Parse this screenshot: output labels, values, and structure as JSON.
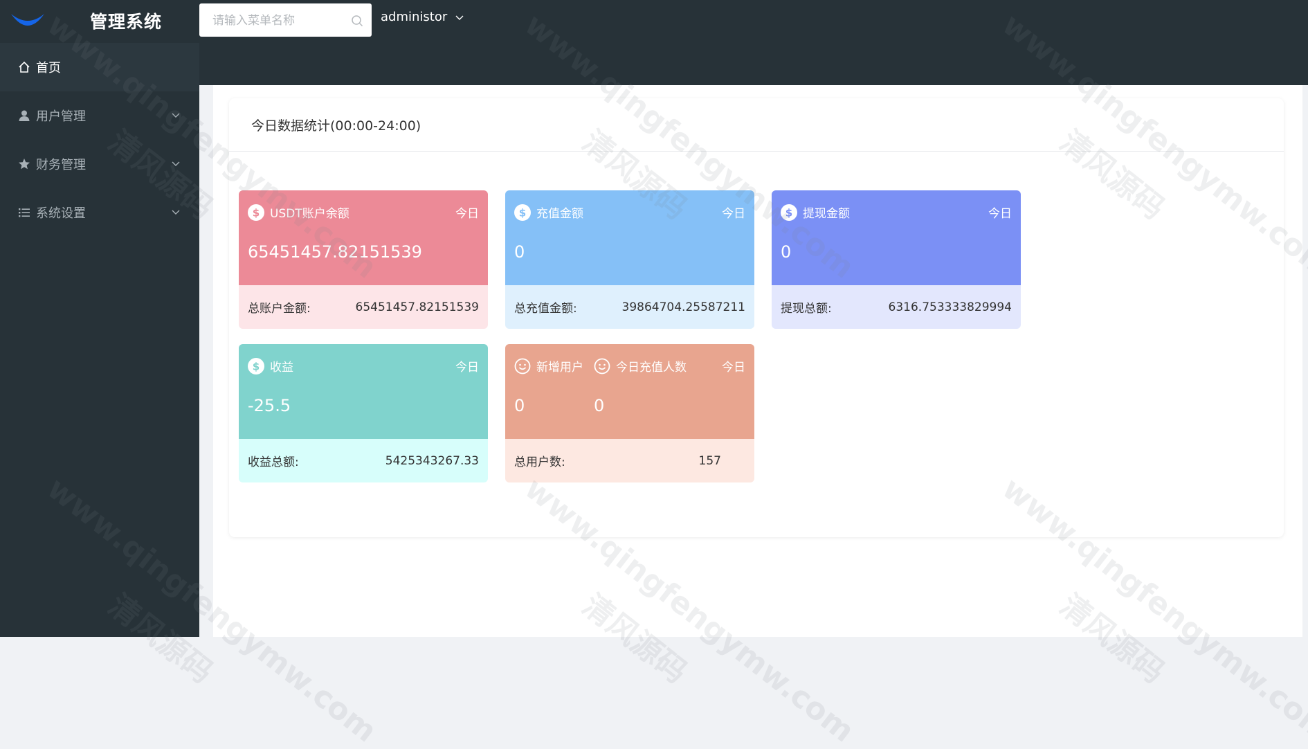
{
  "app": {
    "title": "管理系统"
  },
  "sidebar": {
    "items": [
      {
        "label": "首页",
        "icon": "home-icon"
      },
      {
        "label": "用户管理",
        "icon": "user-icon"
      },
      {
        "label": "财务管理",
        "icon": "star-icon"
      },
      {
        "label": "系统设置",
        "icon": "list-icon"
      }
    ]
  },
  "header": {
    "search_placeholder": "请输入菜单名称",
    "user_name": "administor"
  },
  "panel": {
    "title": "今日数据统计(00:00-24:00)"
  },
  "cards": [
    {
      "title": "USDT账户余额",
      "today": "今日",
      "value": "65451457.82151539",
      "footer_label": "总账户金额:",
      "footer_value": "65451457.82151539",
      "top_color": "#ec8a97",
      "bottom_color": "#fde5e8"
    },
    {
      "title": "充值金额",
      "today": "今日",
      "value": "0",
      "footer_label": "总充值金额:",
      "footer_value": "39864704.25587211",
      "top_color": "#85c0f7",
      "bottom_color": "#dff0fd"
    },
    {
      "title": "提现金额",
      "today": "今日",
      "value": "0",
      "footer_label": "提现总额:",
      "footer_value": "6316.753333829994",
      "top_color": "#7b90f5",
      "bottom_color": "#e3e7fd"
    },
    {
      "title": "收益",
      "today": "今日",
      "value": "-25.5",
      "footer_label": "收益总额:",
      "footer_value": "5425343267.33",
      "top_color": "#80d3cd",
      "bottom_color": "#d7fefb"
    },
    {
      "title": "新增用户",
      "title2": "今日充值人数",
      "today": "今日",
      "value": "0",
      "value2": "0",
      "footer_label": "总用户数:",
      "footer_value": "157",
      "top_color": "#e8a58f",
      "bottom_color": "#fde8e1"
    }
  ],
  "watermark": {
    "text1": "www.qingfengymw.com",
    "text2": "清风源码"
  }
}
